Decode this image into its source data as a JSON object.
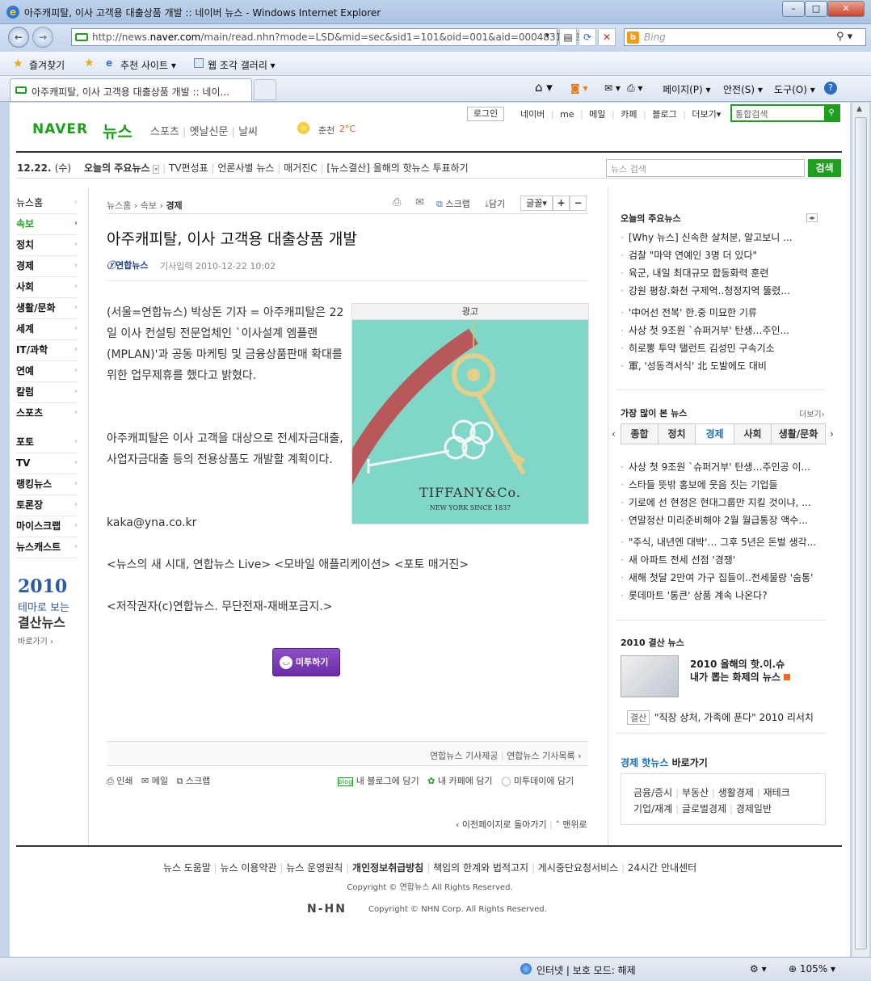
{
  "window": {
    "title": "아주캐피탈, 이사 고객용 대출상품 개발 :: 네이버 뉴스 - Windows Internet Explorer",
    "min": "–",
    "max": "□",
    "close": "✕"
  },
  "address": {
    "prefix": "http://news.",
    "domain": "naver.com",
    "rest": "/main/read.nhn?mode=LSD&mid=sec&sid1=101&oid=001&aid=0004831272"
  },
  "search": {
    "placeholder": "Bing"
  },
  "favbar": {
    "favorites": "즐겨찾기",
    "suggested": "추천 사이트 ▾",
    "gallery": "웹 조각 갤러리 ▾"
  },
  "tab": {
    "title": "아주캐피탈, 이사 고객용 대출상품 개발 :: 네이..."
  },
  "commandbar": {
    "page": "페이지(P) ▾",
    "safety": "안전(S) ▾",
    "tools": "도구(O) ▾"
  },
  "statusbar": {
    "zone": "인터넷 | 보호 모드: 해제",
    "zoom": "105%"
  },
  "naver": {
    "logo": "NAVER",
    "news": "뉴스",
    "gnb": [
      "스포츠",
      "옛날신문",
      "날씨"
    ],
    "weather": {
      "city": "춘천",
      "temp": "2°C"
    },
    "login": "로그인",
    "toplinks": [
      "네이버",
      "me",
      "메일",
      "카페",
      "블로그",
      "더보기▾"
    ],
    "topsearch": "통합검색",
    "date": "12.22.",
    "day": "(수)",
    "subnav": [
      "오늘의 주요뉴스",
      "TV편성표",
      "언론사별 뉴스",
      "매거진C",
      "[뉴스결산] 올해의 핫뉴스 투표하기"
    ],
    "newssearch_placeholder": "뉴스 검색",
    "newssearch_btn": "검색",
    "lnb": [
      "뉴스홈",
      "속보",
      "정치",
      "경제",
      "사회",
      "생활/문화",
      "세계",
      "IT/과학",
      "연예",
      "칼럼",
      "스포츠"
    ],
    "lnb2": [
      "포토",
      "TV",
      "랭킹뉴스",
      "토론장",
      "마이스크랩",
      "뉴스캐스트"
    ],
    "promo": {
      "year": "2010",
      "line1": "테마로 보는",
      "line2": "결산뉴스",
      "more": "바로가기 ›"
    },
    "breadcrumb": [
      "뉴스홈",
      "속보",
      "경제"
    ],
    "tools": {
      "scrap": "스크랩",
      "save": "담기",
      "font": "글꼴▾",
      "plus": "+",
      "minus": "−"
    },
    "article": {
      "title": "아주캐피탈, 이사 고객용 대출상품 개발",
      "source": "연합뉴스",
      "time": "기사입력 2010-12-22 10:02",
      "p1": "(서울=연합뉴스) 박상돈 기자 = 아주캐피탈은 22일 이사 컨설팅 전문업체인 `이사설계 엠플랜(MPLAN)'과 공동 마케팅 및 금융상품판매 확대를 위한 업무제휴를 했다고 밝혔다.",
      "p2": "아주캐피탈은 이사 고객을 대상으로 전세자금대출, 사업자금대출 등의 전용상품도 개발할 계획이다.",
      "email": "kaka@yna.co.kr",
      "promo": "<뉴스의 새 시대, 연합뉴스 Live> <모바일 애플리케이션> <포토 매거진>",
      "copyright": "<저작권자(c)연합뉴스. 무단전재-재배포금지.>",
      "metoo": "미투하기"
    },
    "ad": {
      "label": "광고",
      "brand": "TIFFANY&Co.",
      "sub": "NEW YORK SINCE 1837"
    },
    "bottom": {
      "provider": "연합뉴스 기사제공",
      "list": "연합뉴스 기사목록 ›",
      "print": "인쇄",
      "mail": "메일",
      "scrap": "스크랩",
      "blog": "내 블로그에 담기",
      "cafe": "내 카페에 담기",
      "metoo": "미투데이에 담기",
      "back": "‹ 이전페이지로 돌아가기",
      "top": "˄ 맨위로"
    },
    "right": {
      "today_title": "오늘의 주요뉴스",
      "today": [
        "[Why 뉴스] 신속한 살처분, 알고보니 ...",
        "검찰 \"마약 연예인 3명 더 있다\"",
        "육군, 내일 최대규모 합동화력 훈련",
        "강원 평창.화천 구제역..청정지역 뚫렸...",
        "'中어선 전복' 한.중 미묘한 기류",
        "사상 첫 9조원 `슈퍼거부' 탄생…주인...",
        "히로뽕 투약 탤런트 김성민 구속기소",
        "軍, '성동격서식' 北 도발에도 대비"
      ],
      "most_title": "가장 많이 본 뉴스",
      "more": "더보기›",
      "tabs": [
        "종합",
        "정치",
        "경제",
        "사회",
        "생활/문화"
      ],
      "most": [
        "사상 첫 9조원 `슈퍼거부' 탄생…주인공 이...",
        "스타들 뜻밖 홍보에 웃음 짓는 기업들",
        "기로에 선 현정은 현대그룹만 지킬 것이냐, ...",
        "연말정산 미리준비해야 2월 월급통장 액수...",
        "\"주식, 내년엔 대박'… 그후 5년은 돈벌 생각...",
        "새 아파트 전세 선점 '경쟁'",
        "새해 첫달 2만여 가구 집들이..전세물량 '숨통'",
        "롯데마트 '통큰' 상품 계속 나온다?"
      ],
      "y2010_title": "2010 결산 뉴스",
      "y2010_line1": "2010 올해의 핫.이.슈",
      "y2010_line2": "내가 뽑는 화제의 뉴스",
      "y2010_tag": "결산",
      "y2010_item": "\"직장 상처, 가족에 푼다\" 2010 리서치",
      "hot_title": "경제 핫뉴스",
      "hot_sub": "바로가기",
      "hot_row1": [
        "금융/증시",
        "부동산",
        "생활경제",
        "재테크"
      ],
      "hot_row2": [
        "기업/재계",
        "글로벌경제",
        "경제일반"
      ]
    },
    "footer": {
      "links": [
        "뉴스 도움말",
        "뉴스 이용약관",
        "뉴스 운영원칙",
        "개인정보취급방침",
        "책임의 한계와 법적고지",
        "게시중단요청서비스",
        "24시간 안내센터"
      ],
      "c1": "Copyright © 연합뉴스 All Rights Reserved.",
      "nhn": "N-HN",
      "c2": "Copyright © NHN Corp. All Rights Reserved."
    }
  }
}
